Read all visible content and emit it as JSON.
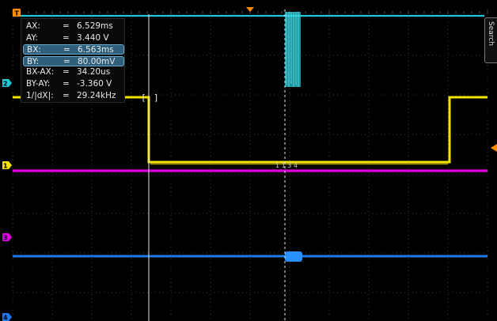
{
  "measurements": [
    {
      "label": "AX:",
      "eq": "=",
      "value": "6.529ms",
      "highlight": false
    },
    {
      "label": "AY:",
      "eq": "=",
      "value": "3.440 V",
      "highlight": false
    },
    {
      "label": "BX:",
      "eq": "=",
      "value": "6.563ms",
      "highlight": true
    },
    {
      "label": "BY:",
      "eq": "=",
      "value": "80.00mV",
      "highlight": true
    },
    {
      "label": "BX-AX:",
      "eq": "=",
      "value": "34.20us",
      "highlight": false
    },
    {
      "label": "BY-AY:",
      "eq": "=",
      "value": "-3.360 V",
      "highlight": false
    },
    {
      "label": "1/|dX|:",
      "eq": "=",
      "value": "29.24kHz",
      "highlight": false
    }
  ],
  "channel_markers": [
    {
      "number": "2",
      "color": "#20c8d8"
    },
    {
      "number": "1",
      "color": "#f2e400"
    },
    {
      "number": "3",
      "color": "#e000e0"
    },
    {
      "number": "4",
      "color": "#2078e8"
    }
  ],
  "trigger_marker_label": "T",
  "side_menu_label": "Search",
  "cursor_bracket_labels": [
    "[",
    "]"
  ],
  "center_label": "1 1 3 4",
  "colors": {
    "ch1": "#f2e400",
    "ch2": "#20c8d8",
    "ch3": "#e000e0",
    "ch4": "#2078e8",
    "trigger": "#ff8c00",
    "grid": "#3a3a3a",
    "cursor": "#e8e8e8"
  }
}
